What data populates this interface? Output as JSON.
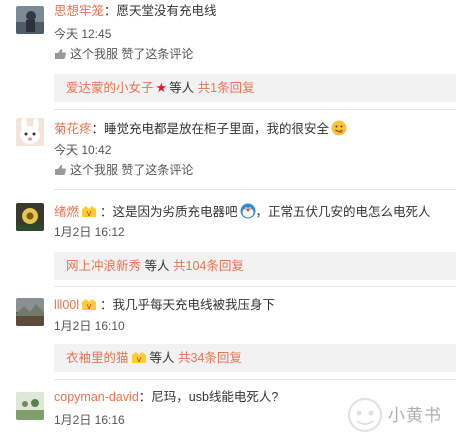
{
  "comments": [
    {
      "user": "思想牢笼",
      "text": "：愿天堂没有充电线",
      "time": "今天 12:45",
      "meta": "这个我服 赞了这条评论",
      "reply": {
        "who": "爱达蒙的小女子",
        "etc": "等人",
        "count": "共1条回复"
      }
    },
    {
      "user": "菊花疼",
      "text": "：睡觉充电都是放在柜子里面，我的很安全",
      "time": "今天 10:42",
      "meta": "这个我服 赞了这条评论"
    },
    {
      "user": "绪燃",
      "text": "：这是因为劣质充电器吧",
      "text2": "，正常五伏几安的电怎么电死人",
      "time": "1月2日 16:12",
      "reply": {
        "who": "网上冲浪新秀",
        "etc": "等人",
        "count": "共104条回复"
      }
    },
    {
      "user": "lll00l",
      "text": "：我几乎每天充电线被我压身下",
      "time": "1月2日 16:10",
      "reply": {
        "who": "衣袖里的猫",
        "etc": "等人",
        "count": "共34条回复"
      }
    },
    {
      "user": "copyman-david",
      "text": "：尼玛，usb线能电死人?",
      "time": "1月2日 16:16"
    }
  ],
  "watermark": "小黄书",
  "colors": {
    "username": "#eb7350",
    "reply_bg": "#f2f2f2"
  }
}
